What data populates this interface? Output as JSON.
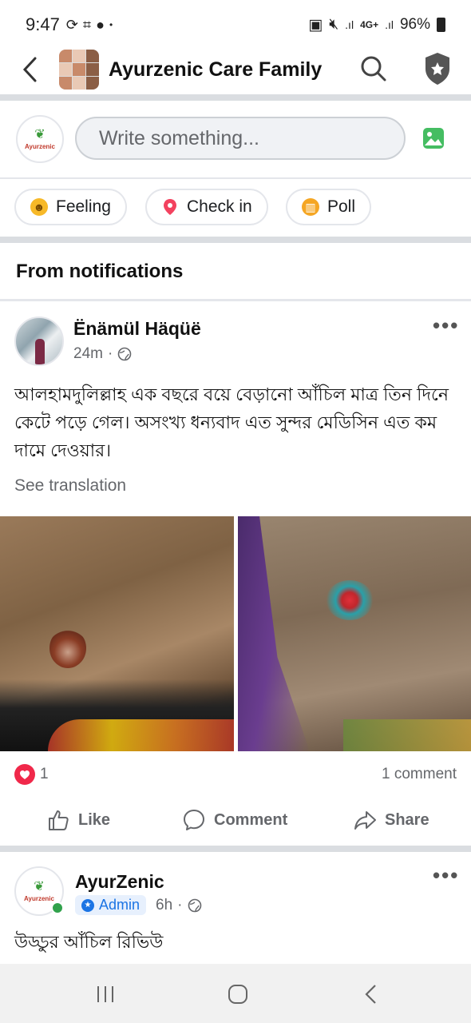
{
  "status_bar": {
    "time": "9:47",
    "network": "4G+",
    "battery": "96%"
  },
  "header": {
    "group_name": "Ayurzenic Care Family"
  },
  "composer": {
    "logo_text": "Ayurzenic",
    "placeholder": "Write something..."
  },
  "chips": {
    "feeling": "Feeling",
    "checkin": "Check in",
    "poll": "Poll"
  },
  "section_title": "From notifications",
  "post1": {
    "author": "Ënämül Häqüë",
    "time": "24m",
    "text": "আলহামদুলিল্লাহ এক বছরে বয়ে বেড়ানো আঁচিল মাত্র তিন দিনে কেটে পড়ে গেল। অসংখ্য ধন্যবাদ এত সুন্দর মেডিসিন এত কম দামে দেওয়ার।",
    "see_translation": "See translation",
    "reaction_count": "1",
    "comment_count": "1 comment",
    "like_label": "Like",
    "comment_label": "Comment",
    "share_label": "Share"
  },
  "post2": {
    "author": "AyurZenic",
    "logo_text": "Ayurzenic",
    "badge": "Admin",
    "time": "6h",
    "text": "উড্ডুর আঁচিল রিভিউ"
  },
  "colors": {
    "accent": "#1b74e4",
    "like_red": "#f0284a",
    "separator": "#dadde1"
  }
}
